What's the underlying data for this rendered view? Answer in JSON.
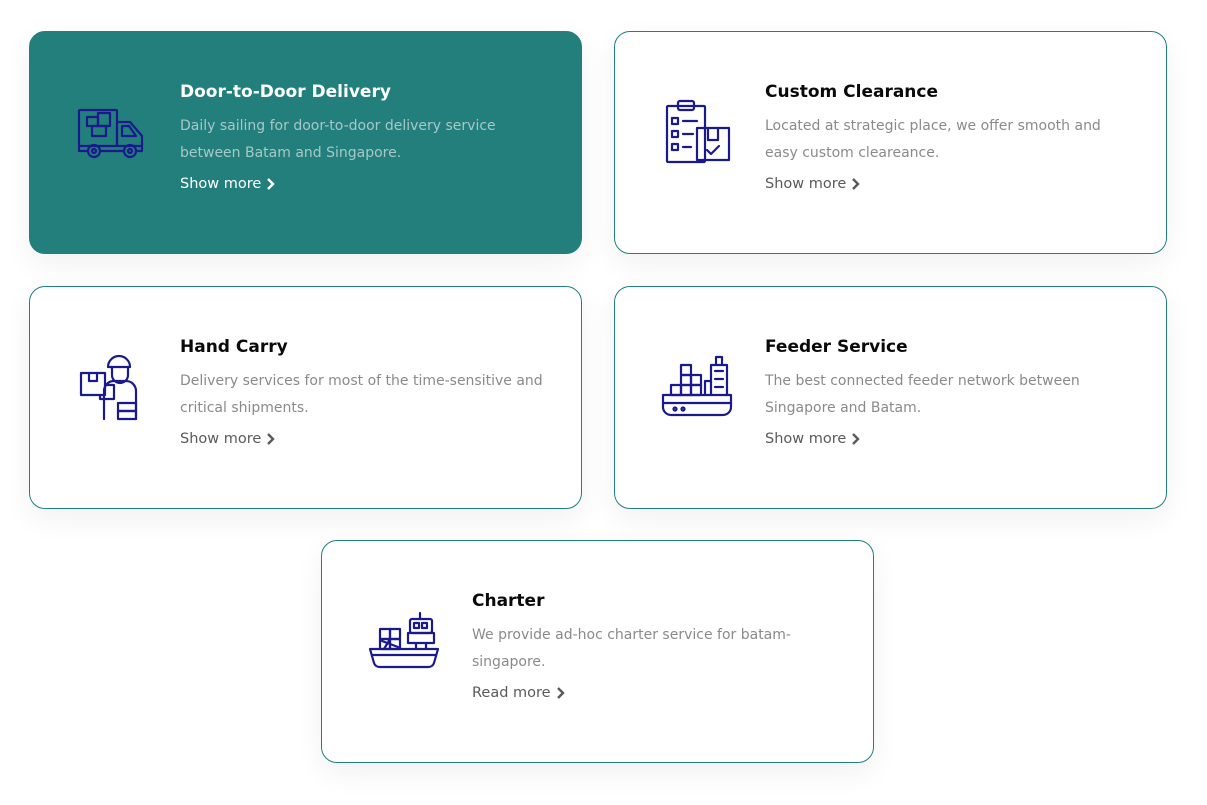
{
  "colors": {
    "accent": "#237f7c",
    "icon": "#1a1a8c",
    "title": "#0a0a0a",
    "text_muted": "#8a8a8a",
    "link": "#5a5a5a"
  },
  "services": [
    {
      "title": "Door-to-Door Delivery",
      "description": "Daily sailing for door-to-door delivery service between Batam and Singapore.",
      "link_label": "Show more",
      "icon": "delivery-truck-icon",
      "active": true
    },
    {
      "title": "Custom Clearance",
      "description": "Located at strategic place, we offer smooth and easy custom cleareance.",
      "link_label": "Show more",
      "icon": "clipboard-checklist-icon",
      "active": false
    },
    {
      "title": "Hand Carry",
      "description": "Delivery services for most of the time-sensitive and critical shipments.",
      "link_label": "Show more",
      "icon": "courier-carrying-box-icon",
      "active": false
    },
    {
      "title": "Feeder Service",
      "description": "The best connected feeder network between Singapore and Batam.",
      "link_label": "Show more",
      "icon": "container-ship-icon",
      "active": false
    },
    {
      "title": "Charter",
      "description": "We provide ad-hoc charter service for batam-singapore.",
      "link_label": "Read more",
      "icon": "cargo-boat-icon",
      "active": false
    }
  ]
}
